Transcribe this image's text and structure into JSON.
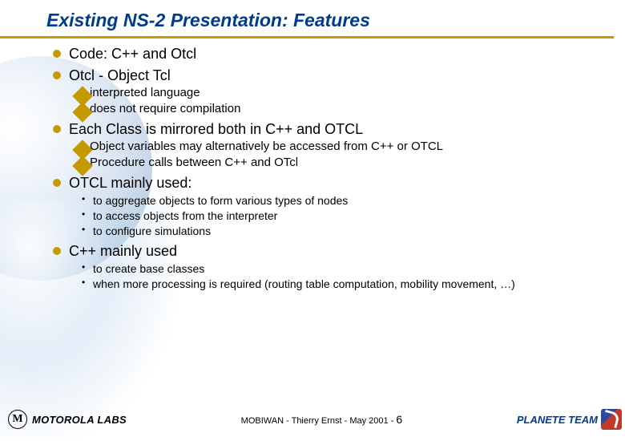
{
  "title": "Existing NS-2 Presentation: Features",
  "bullets": {
    "b1": "Code: C++ and Otcl",
    "b2": "Otcl - Object Tcl",
    "b2_sub": {
      "s1": "interpreted language",
      "s2": "does not require compilation"
    },
    "b3": "Each Class is mirrored both in C++ and OTCL",
    "b3_sub": {
      "s1": "Object variables may alternatively be accessed from C++ or OTCL",
      "s2": "Procedure calls between C++ and OTcl"
    },
    "b4": "OTCL mainly used:",
    "b4_sub": {
      "s1": "to aggregate objects to form various types of nodes",
      "s2": "to access objects from the interpreter",
      "s3": "to configure simulations"
    },
    "b5": "C++ mainly used",
    "b5_sub": {
      "s1": "to create base classes",
      "s2": "when more processing is required (routing table computation, mobility movement, …)"
    }
  },
  "footer": {
    "moto_label": "MOTOROLA LABS",
    "center_prefix": "MOBIWAN - Thierry Ernst - May 2001 - ",
    "page": "6",
    "right": "PLANETE TEAM"
  }
}
